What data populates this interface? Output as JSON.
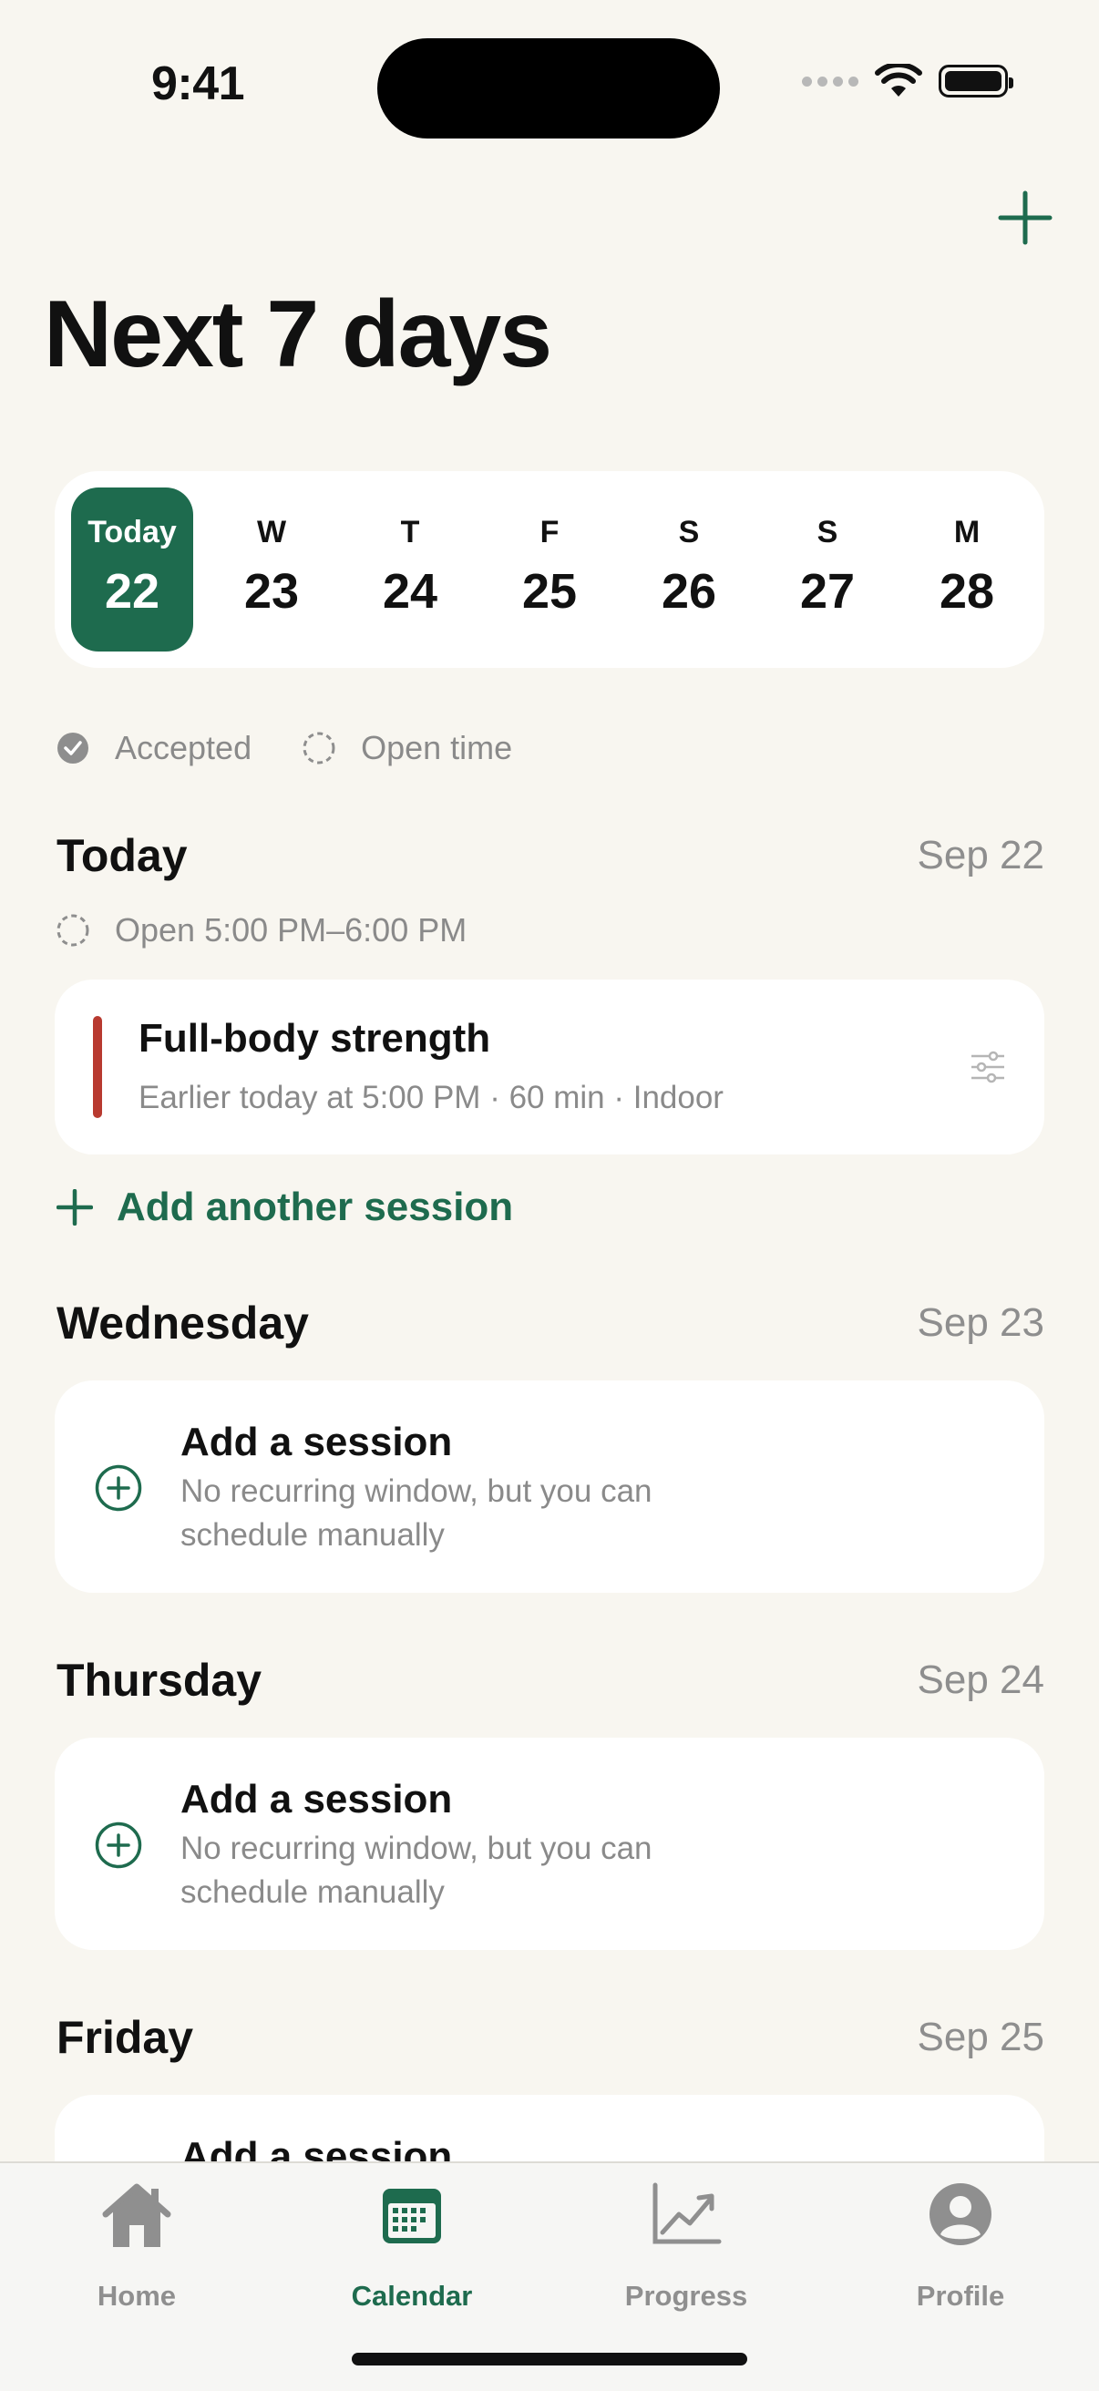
{
  "status_bar": {
    "time": "9:41"
  },
  "header": {
    "title": "Next 7 days"
  },
  "week_strip": [
    {
      "label": "Today",
      "number": "22",
      "selected": true
    },
    {
      "label": "W",
      "number": "23"
    },
    {
      "label": "T",
      "number": "24"
    },
    {
      "label": "F",
      "number": "25"
    },
    {
      "label": "S",
      "number": "26"
    },
    {
      "label": "S",
      "number": "27"
    },
    {
      "label": "M",
      "number": "28"
    }
  ],
  "legend": {
    "accepted": "Accepted",
    "open_time": "Open time"
  },
  "today": {
    "title": "Today",
    "date": "Sep 22",
    "open_window": "Open 5:00 PM–6:00 PM",
    "session": {
      "title": "Full-body strength",
      "meta": "Earlier today at 5:00 PM · 60 min · Indoor"
    },
    "add_another": "Add another session"
  },
  "days": [
    {
      "title": "Wednesday",
      "date": "Sep 23",
      "add_title": "Add a session",
      "add_desc": "No recurring window, but you can schedule manually"
    },
    {
      "title": "Thursday",
      "date": "Sep 24",
      "add_title": "Add a session",
      "add_desc": "No recurring window, but you can schedule manually"
    },
    {
      "title": "Friday",
      "date": "Sep 25",
      "add_title": "Add a session"
    }
  ],
  "tabbar": [
    {
      "label": "Home",
      "icon": "home-icon"
    },
    {
      "label": "Calendar",
      "icon": "calendar-icon",
      "active": true
    },
    {
      "label": "Progress",
      "icon": "chart-icon"
    },
    {
      "label": "Profile",
      "icon": "person-icon"
    }
  ],
  "colors": {
    "accent": "#1E6B4E",
    "session_bar": "#B83A30",
    "background": "#F8F6F0"
  }
}
